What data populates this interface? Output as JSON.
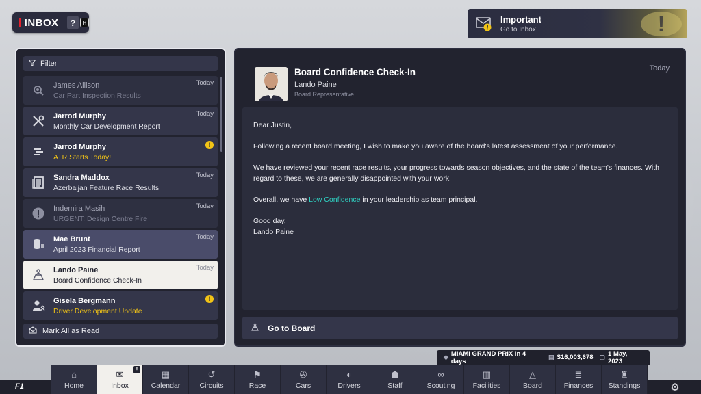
{
  "header": {
    "title": "INBOX",
    "help_label": "?",
    "help_key": "H"
  },
  "notification": {
    "title": "Important",
    "subtitle": "Go to Inbox",
    "icon": "mail-alert-icon",
    "accent": "#f2c416"
  },
  "list": {
    "filter_label": "Filter",
    "mark_all_label": "Mark All as Read",
    "items": [
      {
        "name": "James Allison",
        "subject": "Car Part Inspection Results",
        "date": "Today",
        "icon": "inspection-icon",
        "state": "read"
      },
      {
        "name": "Jarrod Murphy",
        "subject": "Monthly Car Development Report",
        "date": "Today",
        "icon": "tools-icon",
        "state": "unread"
      },
      {
        "name": "Jarrod Murphy",
        "subject": "ATR Starts Today!",
        "date": "",
        "icon": "speed-lines-icon",
        "state": "alert"
      },
      {
        "name": "Sandra Maddox",
        "subject": "Azerbaijan Feature Race Results",
        "date": "Today",
        "icon": "newspaper-icon",
        "state": "unread"
      },
      {
        "name": "Indemira Masih",
        "subject": "URGENT: Design Centre Fire",
        "date": "Today",
        "icon": "exclamation-icon",
        "state": "read"
      },
      {
        "name": "Mae Brunt",
        "subject": "April 2023 Financial Report",
        "date": "Today",
        "icon": "finance-icon",
        "state": "highlight"
      },
      {
        "name": "Lando Paine",
        "subject": "Board Confidence Check-In",
        "date": "Today",
        "icon": "board-icon",
        "state": "selected"
      },
      {
        "name": "Gisela Bergmann",
        "subject": "Driver Development Update",
        "date": "",
        "icon": "driver-development-icon",
        "state": "alert"
      }
    ]
  },
  "message": {
    "title": "Board Confidence Check-In",
    "from": "Lando Paine",
    "role": "Board Representative",
    "date": "Today",
    "greeting": "Dear Justin,",
    "p1": "Following a recent board meeting, I wish to make you aware of the board's latest assessment of your performance.",
    "p2": "We have reviewed your recent race results, your progress towards season objectives, and the state of the team's finances. With regard to these, we are generally disappointed with your work.",
    "p3_pre": "Overall, we have ",
    "p3_highlight": "Low Confidence",
    "p3_post": " in your leadership as team principal.",
    "signoff": "Good day,",
    "signature": "Lando Paine",
    "action_label": "Go to Board",
    "highlight_color": "#2fd3c4"
  },
  "status": {
    "next_race": "MIAMI GRAND PRIX in 4 days",
    "balance": "$16,003,678",
    "date": "1 May, 2023"
  },
  "nav": {
    "tabs": [
      {
        "label": "Home",
        "icon": "home-icon"
      },
      {
        "label": "Inbox",
        "icon": "mail-icon",
        "active": true,
        "badge": "!"
      },
      {
        "label": "Calendar",
        "icon": "calendar-icon"
      },
      {
        "label": "Circuits",
        "icon": "circuit-icon"
      },
      {
        "label": "Race",
        "icon": "flag-icon"
      },
      {
        "label": "Cars",
        "icon": "car-icon"
      },
      {
        "label": "Drivers",
        "icon": "helmet-icon"
      },
      {
        "label": "Staff",
        "icon": "staff-icon"
      },
      {
        "label": "Scouting",
        "icon": "binoculars-icon"
      },
      {
        "label": "Facilities",
        "icon": "facilities-icon"
      },
      {
        "label": "Board",
        "icon": "board-icon"
      },
      {
        "label": "Finances",
        "icon": "coins-icon"
      },
      {
        "label": "Standings",
        "icon": "trophy-icon"
      }
    ]
  },
  "brand": {
    "logo_text": "F1"
  }
}
